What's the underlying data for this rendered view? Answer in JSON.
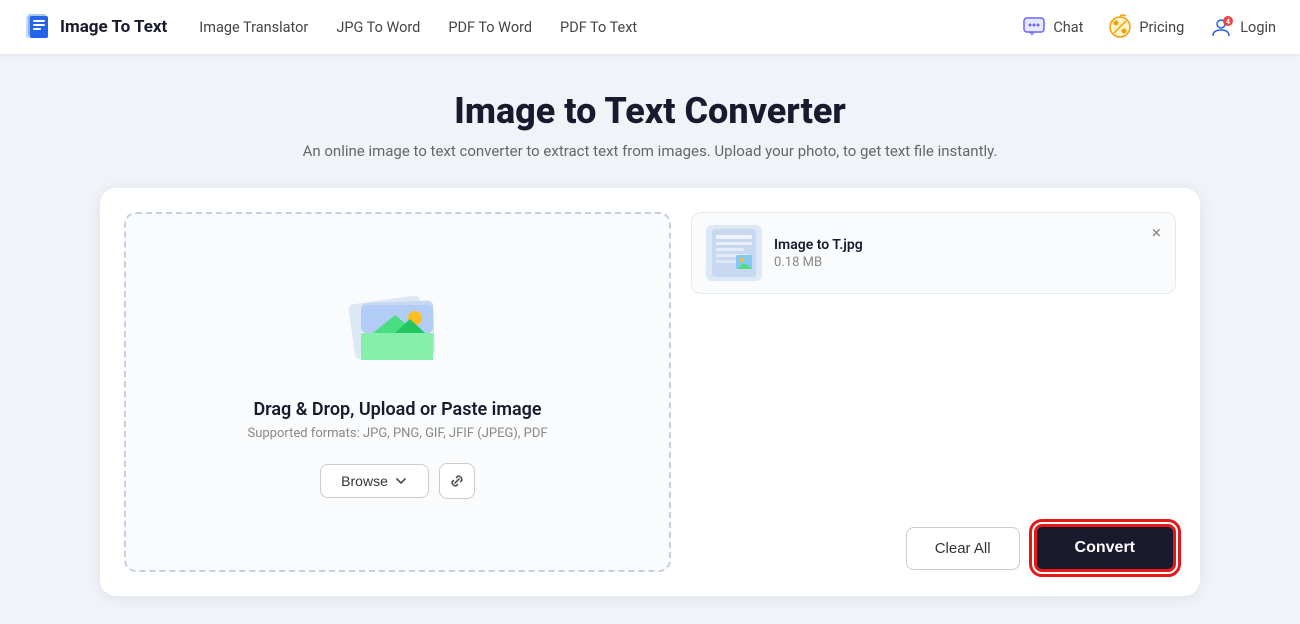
{
  "brand": {
    "name": "Image To Text"
  },
  "nav": {
    "links": [
      {
        "label": "Image Translator",
        "id": "image-translator"
      },
      {
        "label": "JPG To Word",
        "id": "jpg-to-word"
      },
      {
        "label": "PDF To Word",
        "id": "pdf-to-word"
      },
      {
        "label": "PDF To Text",
        "id": "pdf-to-text"
      }
    ],
    "chat_label": "Chat",
    "pricing_label": "Pricing",
    "login_label": "Login"
  },
  "page": {
    "title": "Image to Text Converter",
    "subtitle": "An online image to text converter to extract text from images. Upload your photo, to get text file instantly."
  },
  "dropzone": {
    "title": "Drag & Drop, Upload or Paste image",
    "subtitle": "Supported formats: JPG, PNG, GIF, JFIF (JPEG), PDF",
    "browse_label": "Browse"
  },
  "files": [
    {
      "name": "Image to T.jpg",
      "size": "0.18 MB"
    }
  ],
  "actions": {
    "clear_label": "Clear All",
    "convert_label": "Convert"
  }
}
